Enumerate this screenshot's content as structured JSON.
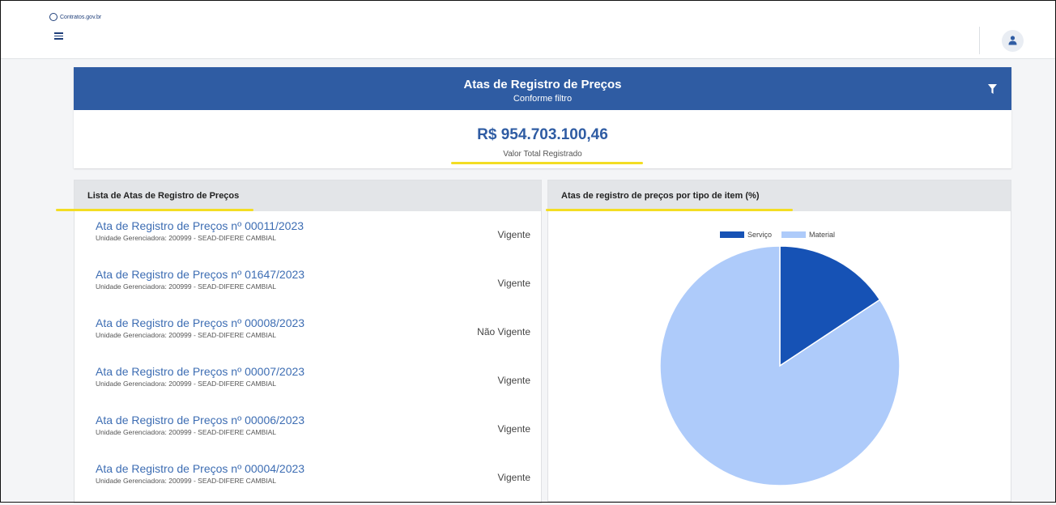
{
  "app": {
    "logo_text": "Contratos.gov.br"
  },
  "summary": {
    "title": "Atas de Registro de Preços",
    "subtitle": "Conforme filtro",
    "total_value": "R$ 954.703.100,46",
    "total_label": "Valor Total Registrado"
  },
  "list": {
    "header": "Lista de Atas de Registro de Preços",
    "items": [
      {
        "title": "Ata de Registro de Preços nº 00011/2023",
        "unit": "Unidade Gerenciadora: 200999 - SEAD-DIFERE CAMBIAL",
        "status": "Vigente"
      },
      {
        "title": "Ata de Registro de Preços nº 01647/2023",
        "unit": "Unidade Gerenciadora: 200999 - SEAD-DIFERE CAMBIAL",
        "status": "Vigente"
      },
      {
        "title": "Ata de Registro de Preços nº 00008/2023",
        "unit": "Unidade Gerenciadora: 200999 - SEAD-DIFERE CAMBIAL",
        "status": "Não Vigente"
      },
      {
        "title": "Ata de Registro de Preços nº 00007/2023",
        "unit": "Unidade Gerenciadora: 200999 - SEAD-DIFERE CAMBIAL",
        "status": "Vigente"
      },
      {
        "title": "Ata de Registro de Preços nº 00006/2023",
        "unit": "Unidade Gerenciadora: 200999 - SEAD-DIFERE CAMBIAL",
        "status": "Vigente"
      },
      {
        "title": "Ata de Registro de Preços nº 00004/2023",
        "unit": "Unidade Gerenciadora: 200999 - SEAD-DIFERE CAMBIAL",
        "status": "Vigente"
      }
    ]
  },
  "chart_panel": {
    "header": "Atas de registro de preços por tipo de item (%)"
  },
  "icons": {
    "menu": "menu-icon",
    "user": "user-icon",
    "filter": "filter-icon"
  },
  "colors": {
    "header_blue": "#2f5ca3",
    "highlight": "#f3dd23",
    "servico": "#1652b5",
    "material": "#aecbfa"
  },
  "chart_data": {
    "type": "pie",
    "categories": [
      "Serviço",
      "Material"
    ],
    "values": [
      15.7,
      84.3
    ],
    "legend": "top"
  }
}
